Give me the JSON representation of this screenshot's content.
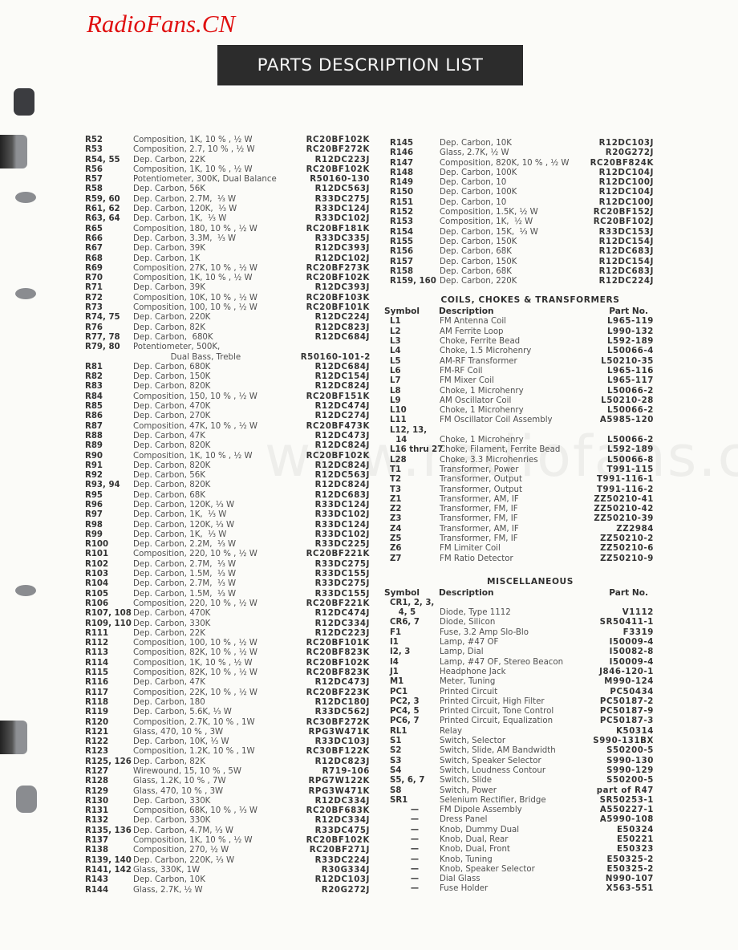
{
  "watermark_logo": "RadioFans.CN",
  "watermark_url": "www.radiofans.cn",
  "title": "PARTS DESCRIPTION LIST",
  "resistors_left": [
    {
      "symbol": "R52",
      "description": "Composition, 1K, 10 % , ½ W",
      "part_no": "RC20BF102K"
    },
    {
      "symbol": "R53",
      "description": "Composition, 2.7, 10 % , ½ W",
      "part_no": "RC20BF272K"
    },
    {
      "symbol": "R54, 55",
      "description": "Dep. Carbon, 22K",
      "part_no": "R12DC223J"
    },
    {
      "symbol": "R56",
      "description": "Composition, 1K, 10 % , ½ W",
      "part_no": "RC20BF102K"
    },
    {
      "symbol": "R57",
      "description": "Potentiometer, 300K, Dual Balance",
      "part_no": "R50160-130"
    },
    {
      "symbol": "R58",
      "description": "Dep. Carbon, 56K",
      "part_no": "R12DC563J"
    },
    {
      "symbol": "R59, 60",
      "description": "Dep. Carbon, 2.7M,  ⅓ W",
      "part_no": "R33DC275J"
    },
    {
      "symbol": "R61, 62",
      "description": "Dep. Carbon, 120K,  ⅓ W",
      "part_no": "R33DC124J"
    },
    {
      "symbol": "R63, 64",
      "description": "Dep. Carbon, 1K,  ⅓ W",
      "part_no": "R33DC102J"
    },
    {
      "symbol": "R65",
      "description": "Composition, 180, 10 % , ½ W",
      "part_no": "RC20BF181K"
    },
    {
      "symbol": "R66",
      "description": "Dep. Carbon, 3.3M,  ⅓ W",
      "part_no": "R33DC335J"
    },
    {
      "symbol": "R67",
      "description": "Dep. Carbon, 39K",
      "part_no": "R12DC393J"
    },
    {
      "symbol": "R68",
      "description": "Dep. Carbon, 1K",
      "part_no": "R12DC102J"
    },
    {
      "symbol": "R69",
      "description": "Composition, 27K, 10 % , ½ W",
      "part_no": "RC20BF273K"
    },
    {
      "symbol": "R70",
      "description": "Composition, 1K, 10 % , ½ W",
      "part_no": "RC20BF102K"
    },
    {
      "symbol": "R71",
      "description": "Dep. Carbon, 39K",
      "part_no": "R12DC393J"
    },
    {
      "symbol": "R72",
      "description": "Composition, 10K, 10 % , ½ W",
      "part_no": "RC20BF103K"
    },
    {
      "symbol": "R73",
      "description": "Composition, 100, 10 % , ½ W",
      "part_no": "RC20BF101K"
    },
    {
      "symbol": "R74, 75",
      "description": "Dep. Carbon, 220K",
      "part_no": "R12DC224J"
    },
    {
      "symbol": "R76",
      "description": "Dep. Carbon, 82K",
      "part_no": "R12DC823J"
    },
    {
      "symbol": "R77, 78",
      "description": "Dep. Carbon,  680K",
      "part_no": "R12DC684J"
    },
    {
      "symbol": "R79, 80",
      "description": "Potentiometer, 500K,",
      "part_no": ""
    },
    {
      "symbol": "",
      "description": "Dual Bass, Treble",
      "part_no": "R50160-101-2",
      "indent": true
    },
    {
      "symbol": "R81",
      "description": "Dep. Carbon, 680K",
      "part_no": "R12DC684J"
    },
    {
      "symbol": "R82",
      "description": "Dep. Carbon, 150K",
      "part_no": "R12DC154J"
    },
    {
      "symbol": "R83",
      "description": "Dep. Carbon, 820K",
      "part_no": "R12DC824J"
    },
    {
      "symbol": "R84",
      "description": "Composition, 150, 10 % , ½ W",
      "part_no": "RC20BF151K"
    },
    {
      "symbol": "R85",
      "description": "Dep. Carbon, 470K",
      "part_no": "R12DC474J"
    },
    {
      "symbol": "R86",
      "description": "Dep. Carbon, 270K",
      "part_no": "R12DC274J"
    },
    {
      "symbol": "R87",
      "description": "Composition, 47K, 10 % , ½ W",
      "part_no": "RC20BF473K"
    },
    {
      "symbol": "R88",
      "description": "Dep. Carbon, 47K",
      "part_no": "R12DC473J"
    },
    {
      "symbol": "R89",
      "description": "Dep. Carbon, 820K",
      "part_no": "R12DC824J"
    },
    {
      "symbol": "R90",
      "description": "Composition, 1K, 10 % , ½ W",
      "part_no": "RC20BF102K"
    },
    {
      "symbol": "R91",
      "description": "Dep. Carbon, 820K",
      "part_no": "R12DC824J"
    },
    {
      "symbol": "R92",
      "description": "Dep. Carbon, 56K",
      "part_no": "R12DC563J"
    },
    {
      "symbol": "R93, 94",
      "description": "Dep. Carbon, 820K",
      "part_no": "R12DC824J"
    },
    {
      "symbol": "R95",
      "description": "Dep. Carbon, 68K",
      "part_no": "R12DC683J"
    },
    {
      "symbol": "R96",
      "description": "Dep. Carbon, 120K, ⅓ W",
      "part_no": "R33DC124J"
    },
    {
      "symbol": "R97",
      "description": "Dep. Carbon, 1K,  ⅓ W",
      "part_no": "R33DC102J"
    },
    {
      "symbol": "R98",
      "description": "Dep. Carbon, 120K, ⅓ W",
      "part_no": "R33DC124J"
    },
    {
      "symbol": "R99",
      "description": "Dep. Carbon, 1K,  ⅓ W",
      "part_no": "R33DC102J"
    },
    {
      "symbol": "R100",
      "description": "Dep. Carbon, 2.2M,  ⅓ W",
      "part_no": "R33DC225J"
    },
    {
      "symbol": "R101",
      "description": "Composition, 220, 10 % , ½ W",
      "part_no": "RC20BF221K"
    },
    {
      "symbol": "R102",
      "description": "Dep. Carbon, 2.7M,  ⅓ W",
      "part_no": "R33DC275J"
    },
    {
      "symbol": "R103",
      "description": "Dep. Carbon, 1.5M,  ⅓ W",
      "part_no": "R33DC155J"
    },
    {
      "symbol": "R104",
      "description": "Dep. Carbon, 2.7M,  ⅓ W",
      "part_no": "R33DC275J"
    },
    {
      "symbol": "R105",
      "description": "Dep. Carbon, 1.5M,  ⅓ W",
      "part_no": "R33DC155J"
    },
    {
      "symbol": "R106",
      "description": "Composition, 220, 10 % , ½ W",
      "part_no": "RC20BF221K"
    },
    {
      "symbol": "R107, 108",
      "description": "Dep. Carbon, 470K",
      "part_no": "R12DC474J"
    },
    {
      "symbol": "R109, 110",
      "description": "Dep. Carbon, 330K",
      "part_no": "R12DC334J"
    },
    {
      "symbol": "R111",
      "description": "Dep. Carbon, 22K",
      "part_no": "R12DC223J"
    },
    {
      "symbol": "R112",
      "description": "Composition, 100, 10 % , ½ W",
      "part_no": "RC20BF101K"
    },
    {
      "symbol": "R113",
      "description": "Composition, 82K, 10 % , ½ W",
      "part_no": "RC20BF823K"
    },
    {
      "symbol": "R114",
      "description": "Composition, 1K, 10 % , ½ W",
      "part_no": "RC20BF102K"
    },
    {
      "symbol": "R115",
      "description": "Composition, 82K, 10 % , ½ W",
      "part_no": "RC20BF823K"
    },
    {
      "symbol": "R116",
      "description": "Dep. Carbon, 47K",
      "part_no": "R12DC473J"
    },
    {
      "symbol": "R117",
      "description": "Composition, 22K, 10 % , ½ W",
      "part_no": "RC20BF223K"
    },
    {
      "symbol": "R118",
      "description": "Dep. Carbon, 180",
      "part_no": "R12DC180J"
    },
    {
      "symbol": "R119",
      "description": "Dep. Carbon, 5.6K, ⅓ W",
      "part_no": "R33DC562J"
    },
    {
      "symbol": "R120",
      "description": "Composition, 2.7K, 10 % , 1W",
      "part_no": "RC30BF272K"
    },
    {
      "symbol": "R121",
      "description": "Glass, 470, 10 % , 3W",
      "part_no": "RPG3W471K"
    },
    {
      "symbol": "R122",
      "description": "Dep. Carbon, 10K, ⅓ W",
      "part_no": "R33DC103J"
    },
    {
      "symbol": "R123",
      "description": "Composition, 1.2K, 10 % , 1W",
      "part_no": "RC30BF122K"
    },
    {
      "symbol": "R125, 126",
      "description": "Dep. Carbon, 82K",
      "part_no": "R12DC823J"
    },
    {
      "symbol": "R127",
      "description": "Wirewound, 15, 10 % , 5W",
      "part_no": "R719-106"
    },
    {
      "symbol": "R128",
      "description": "Glass, 1.2K, 10 % , 7W",
      "part_no": "RPG7W122K"
    },
    {
      "symbol": "R129",
      "description": "Glass, 470, 10 % , 3W",
      "part_no": "RPG3W471K"
    },
    {
      "symbol": "R130",
      "description": "Dep. Carbon, 330K",
      "part_no": "R12DC334J"
    },
    {
      "symbol": "R131",
      "description": "Composition, 68K, 10 % , ⅓ W",
      "part_no": "RC20BF683K"
    },
    {
      "symbol": "R132",
      "description": "Dep. Carbon, 330K",
      "part_no": "R12DC334J"
    },
    {
      "symbol": "R135, 136",
      "description": "Dep. Carbon, 4.7M, ⅓ W",
      "part_no": "R33DC475J"
    },
    {
      "symbol": "R137",
      "description": "Composition, 1K, 10 % , ½ W",
      "part_no": "RC20BF102K"
    },
    {
      "symbol": "R138",
      "description": "Composition, 270, ½ W",
      "part_no": "RC20BF271J"
    },
    {
      "symbol": "R139, 140",
      "description": "Dep. Carbon, 220K, ⅓ W",
      "part_no": "R33DC224J"
    },
    {
      "symbol": "R141, 142",
      "description": "Glass, 330K, 1W",
      "part_no": "R30G334J"
    },
    {
      "symbol": "R143",
      "description": "Dep. Carbon, 10K",
      "part_no": "R12DC103J"
    },
    {
      "symbol": "R144",
      "description": "Glass, 2.7K, ½ W",
      "part_no": "R20G272J"
    }
  ],
  "resistors_right": [
    {
      "symbol": "R145",
      "description": "Dep. Carbon, 10K",
      "part_no": "R12DC103J"
    },
    {
      "symbol": "R146",
      "description": "Glass, 2.7K, ½ W",
      "part_no": "R20G272J"
    },
    {
      "symbol": "R147",
      "description": "Composition, 820K, 10 % , ½ W",
      "part_no": "RC20BF824K"
    },
    {
      "symbol": "R148",
      "description": "Dep. Carbon, 100K",
      "part_no": "R12DC104J"
    },
    {
      "symbol": "R149",
      "description": "Dep. Carbon, 10",
      "part_no": "R12DC100J"
    },
    {
      "symbol": "R150",
      "description": "Dep. Carbon, 100K",
      "part_no": "R12DC104J"
    },
    {
      "symbol": "R151",
      "description": "Dep. Carbon, 10",
      "part_no": "R12DC100J"
    },
    {
      "symbol": "R152",
      "description": "Composition, 1.5K, ½ W",
      "part_no": "RC20BF152J"
    },
    {
      "symbol": "R153",
      "description": "Composition, 1K,  ½ W",
      "part_no": "RC20BF102J"
    },
    {
      "symbol": "R154",
      "description": "Dep. Carbon, 15K,  ⅓ W",
      "part_no": "R33DC153J"
    },
    {
      "symbol": "R155",
      "description": "Dep. Carbon, 150K",
      "part_no": "R12DC154J"
    },
    {
      "symbol": "R156",
      "description": "Dep. Carbon, 68K",
      "part_no": "R12DC683J"
    },
    {
      "symbol": "R157",
      "description": "Dep. Carbon, 150K",
      "part_no": "R12DC154J"
    },
    {
      "symbol": "R158",
      "description": "Dep. Carbon, 68K",
      "part_no": "R12DC683J"
    },
    {
      "symbol": "R159, 160",
      "description": "Dep. Carbon, 220K",
      "part_no": "R12DC224J"
    }
  ],
  "coils": {
    "title": "COILS, CHOKES & TRANSFORMERS",
    "headers": {
      "symbol": "Symbol",
      "description": "Description",
      "part_no": "Part No."
    },
    "rows": [
      {
        "symbol": "L1",
        "description": "FM Antenna Coil",
        "part_no": "L965-119"
      },
      {
        "symbol": "L2",
        "description": "AM Ferrite Loop",
        "part_no": "L990-132"
      },
      {
        "symbol": "L3",
        "description": "Choke, Ferrite Bead",
        "part_no": "L592-189"
      },
      {
        "symbol": "L4",
        "description": "Choke, 1.5 Microhenry",
        "part_no": "L50066-4"
      },
      {
        "symbol": "L5",
        "description": "AM-RF Transformer",
        "part_no": "L50210-35"
      },
      {
        "symbol": "L6",
        "description": "FM-RF Coil",
        "part_no": "L965-116"
      },
      {
        "symbol": "L7",
        "description": "FM Mixer Coil",
        "part_no": "L965-117"
      },
      {
        "symbol": "L8",
        "description": "Choke, 1 Microhenry",
        "part_no": "L50066-2"
      },
      {
        "symbol": "L9",
        "description": "AM Oscillator Coil",
        "part_no": "L50210-28"
      },
      {
        "symbol": "L10",
        "description": "Choke, 1 Microhenry",
        "part_no": "L50066-2"
      },
      {
        "symbol": "L11",
        "description": "FM Oscillator Coil Assembly",
        "part_no": "A5985-120"
      },
      {
        "symbol": "L12, 13,",
        "description": "",
        "part_no": ""
      },
      {
        "symbol": "  14",
        "description": "Choke, 1 Microhenry",
        "part_no": "L50066-2"
      },
      {
        "symbol": "L16 thru 27",
        "description": "Choke, Filament, Ferrite Bead",
        "part_no": "L592-189"
      },
      {
        "symbol": "L28",
        "description": "Choke, 3.3 Microhenries",
        "part_no": "L50066-8"
      },
      {
        "symbol": "T1",
        "description": "Transformer, Power",
        "part_no": "T991-115"
      },
      {
        "symbol": "T2",
        "description": "Transformer, Output",
        "part_no": "T991-116-1"
      },
      {
        "symbol": "T3",
        "description": "Transformer, Output",
        "part_no": "T991-116-2"
      },
      {
        "symbol": "Z1",
        "description": "Transformer, AM, IF",
        "part_no": "ZZ50210-41"
      },
      {
        "symbol": "Z2",
        "description": "Transformer, FM, IF",
        "part_no": "ZZ50210-42"
      },
      {
        "symbol": "Z3",
        "description": "Transformer, FM, IF",
        "part_no": "ZZ50210-39"
      },
      {
        "symbol": "Z4",
        "description": "Transformer, AM, IF",
        "part_no": "ZZ2984"
      },
      {
        "symbol": "Z5",
        "description": "Transformer, FM, IF",
        "part_no": "ZZ50210-2"
      },
      {
        "symbol": "Z6",
        "description": "FM Limiter Coil",
        "part_no": "ZZ50210-6"
      },
      {
        "symbol": "Z7",
        "description": "FM Ratio Detector",
        "part_no": "ZZ50210-9"
      }
    ]
  },
  "misc": {
    "title": "MISCELLANEOUS",
    "headers": {
      "symbol": "Symbol",
      "description": "Description",
      "part_no": "Part No."
    },
    "rows": [
      {
        "symbol": "CR1, 2, 3,",
        "description": "",
        "part_no": ""
      },
      {
        "symbol": "   4, 5",
        "description": "Diode, Type 1112",
        "part_no": "V1112"
      },
      {
        "symbol": "CR6, 7",
        "description": "Diode, Silicon",
        "part_no": "SR50411-1"
      },
      {
        "symbol": "F1",
        "description": "Fuse, 3.2 Amp Slo-Blo",
        "part_no": "F3319"
      },
      {
        "symbol": "I1",
        "description": "Lamp, #47 OF",
        "part_no": "I50009-4"
      },
      {
        "symbol": "I2, 3",
        "description": "Lamp, Dial",
        "part_no": "I50082-8"
      },
      {
        "symbol": "I4",
        "description": "Lamp, #47 OF, Stereo Beacon",
        "part_no": "I50009-4"
      },
      {
        "symbol": "J1",
        "description": "Headphone Jack",
        "part_no": "J846-120-1"
      },
      {
        "symbol": "M1",
        "description": "Meter, Tuning",
        "part_no": "M990-124"
      },
      {
        "symbol": "PC1",
        "description": "Printed Circuit",
        "part_no": "PC50434"
      },
      {
        "symbol": "PC2, 3",
        "description": "Printed Circuit, High Filter",
        "part_no": "PC50187-2"
      },
      {
        "symbol": "PC4, 5",
        "description": "Printed Circuit, Tone Control",
        "part_no": "PC50187-9"
      },
      {
        "symbol": "PC6, 7",
        "description": "Printed Circuit, Equalization",
        "part_no": "PC50187-3"
      },
      {
        "symbol": "RL1",
        "description": "Relay",
        "part_no": "K50314"
      },
      {
        "symbol": "S1",
        "description": "Switch, Selector",
        "part_no": "S990-131BX"
      },
      {
        "symbol": "S2",
        "description": "Switch, Slide, AM Bandwidth",
        "part_no": "S50200-5"
      },
      {
        "symbol": "S3",
        "description": "Switch, Speaker Selector",
        "part_no": "S990-130"
      },
      {
        "symbol": "S4",
        "description": "Switch, Loudness Contour",
        "part_no": "S990-129"
      },
      {
        "symbol": "S5, 6, 7",
        "description": "Switch, Slide",
        "part_no": "S50200-5"
      },
      {
        "symbol": "S8",
        "description": "Switch, Power",
        "part_no": "part of R47"
      },
      {
        "symbol": "SR1",
        "description": "Selenium Rectifier, Bridge",
        "part_no": "SR50253-1"
      },
      {
        "symbol": "—",
        "description": "FM Dipole Assembly",
        "part_no": "A550227-1"
      },
      {
        "symbol": "—",
        "description": "Dress Panel",
        "part_no": "A5990-108"
      },
      {
        "symbol": "—",
        "description": "Knob, Dummy Dual",
        "part_no": "E50324"
      },
      {
        "symbol": "—",
        "description": "Knob, Dual, Rear",
        "part_no": "E50221"
      },
      {
        "symbol": "—",
        "description": "Knob, Dual, Front",
        "part_no": "E50323"
      },
      {
        "symbol": "—",
        "description": "Knob, Tuning",
        "part_no": "E50325-2"
      },
      {
        "symbol": "—",
        "description": "Knob, Speaker Selector",
        "part_no": "E50325-2"
      },
      {
        "symbol": "—",
        "description": "Dial Glass",
        "part_no": "N990-107"
      },
      {
        "symbol": "—",
        "description": "Fuse Holder",
        "part_no": "X563-551"
      }
    ]
  }
}
